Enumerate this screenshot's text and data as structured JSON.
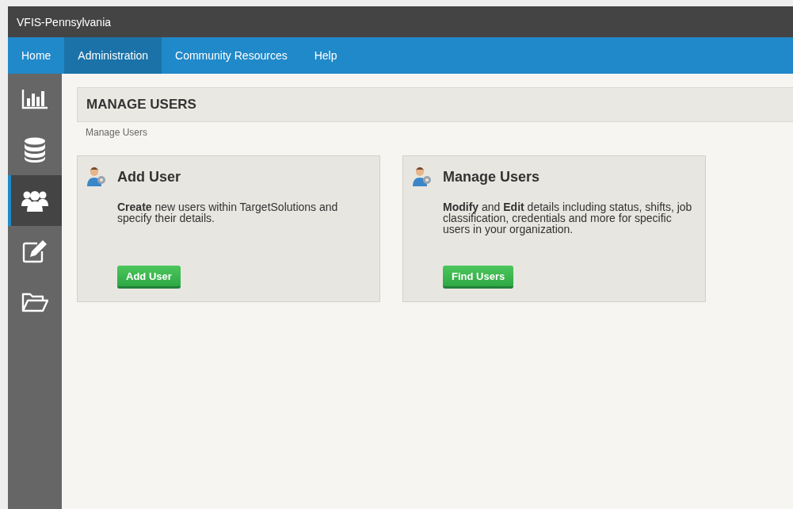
{
  "window": {
    "title": "VFIS-Pennsylvania"
  },
  "nav": [
    {
      "label": "Home",
      "selected": false
    },
    {
      "label": "Administration",
      "selected": true
    },
    {
      "label": "Community Resources",
      "selected": false
    },
    {
      "label": "Help",
      "selected": false
    }
  ],
  "sidebar": {
    "items": [
      {
        "kind": "chart",
        "selected": false
      },
      {
        "kind": "database",
        "selected": false
      },
      {
        "kind": "users",
        "selected": true
      },
      {
        "kind": "edit",
        "selected": false
      },
      {
        "kind": "folder",
        "selected": false
      }
    ]
  },
  "page_header": "MANAGE USERS",
  "breadcrumb": "Manage Users",
  "cards": [
    {
      "title": "Add User",
      "description": "**Create** new users within TargetSolutions and specify their details.",
      "button": "Add User"
    },
    {
      "title": "Manage Users",
      "description": "**Modify** and **Edit** details including status, shifts, job classification, credentials and more for specific users in your organization.",
      "button": "Find Users"
    }
  ]
}
